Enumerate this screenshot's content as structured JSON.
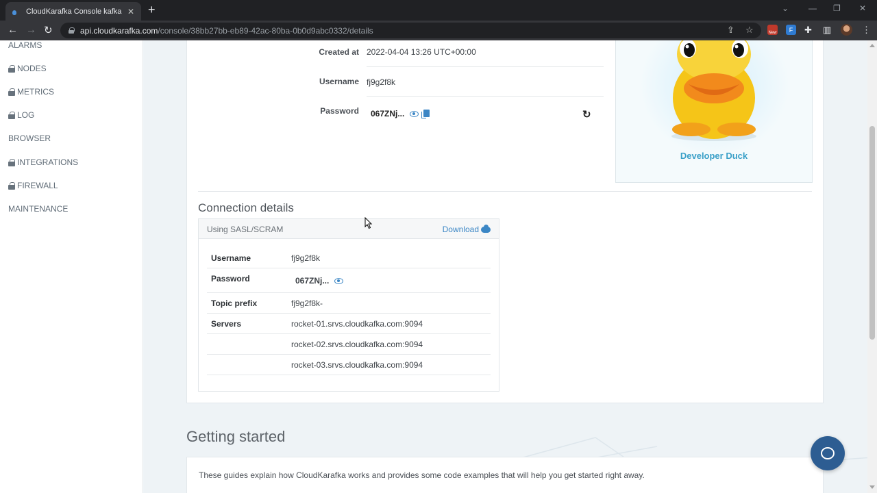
{
  "browser": {
    "tab_title": "CloudKarafka Console kafka app",
    "url_host": "api.cloudkarafka.com",
    "url_path": "/console/38bb27bb-eb89-42ac-80ba-0b0d9abc0332/details",
    "ext_new_badge": "New",
    "ext_f_label": "F"
  },
  "sidebar": {
    "items": [
      {
        "label": "ALARMS",
        "locked": false
      },
      {
        "label": "NODES",
        "locked": true
      },
      {
        "label": "METRICS",
        "locked": true
      },
      {
        "label": "LOG",
        "locked": true
      },
      {
        "label": "BROWSER",
        "locked": false
      },
      {
        "label": "INTEGRATIONS",
        "locked": true
      },
      {
        "label": "FIREWALL",
        "locked": true
      },
      {
        "label": "MAINTENANCE",
        "locked": false
      }
    ]
  },
  "details": {
    "created_label": "Created at",
    "created_value": "2022-04-04 13:26 UTC+00:00",
    "username_label": "Username",
    "username_value": "fj9g2f8k",
    "password_label": "Password",
    "password_value": "067ZNj..."
  },
  "plan": {
    "name": "Developer Duck"
  },
  "connection": {
    "title": "Connection details",
    "method": "Using SASL/SCRAM",
    "download_label": "Download",
    "rows": {
      "username_label": "Username",
      "username_value": "fj9g2f8k",
      "password_label": "Password",
      "password_value": "067ZNj...",
      "topic_label": "Topic prefix",
      "topic_value": "fj9g2f8k-",
      "servers_label": "Servers",
      "servers": [
        "rocket-01.srvs.cloudkafka.com:9094",
        "rocket-02.srvs.cloudkafka.com:9094",
        "rocket-03.srvs.cloudkafka.com:9094"
      ]
    }
  },
  "getting_started": {
    "title": "Getting started",
    "text": "These guides explain how CloudKarafka works and provides some code examples that will help you get started right away."
  },
  "colors": {
    "accent": "#3b86c5",
    "duck_name": "#3aa0c8",
    "chat": "#2d5d92"
  }
}
